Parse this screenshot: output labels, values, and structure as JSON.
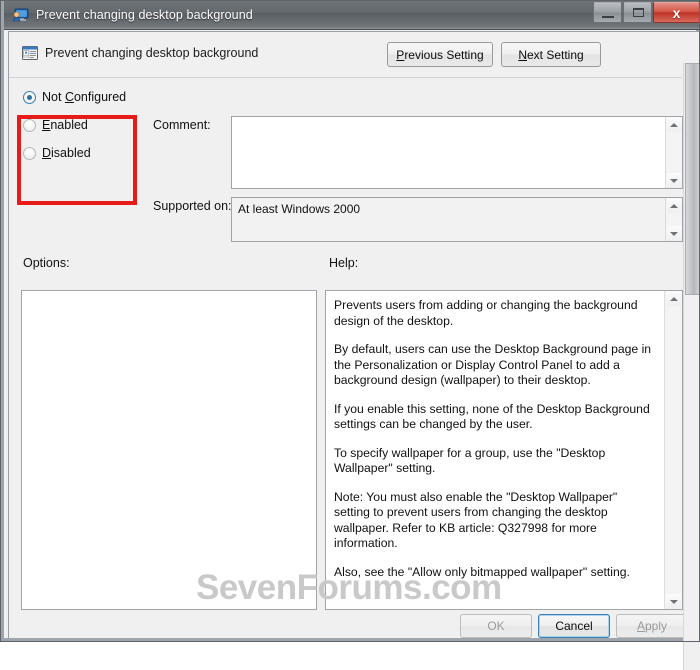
{
  "window": {
    "title": "Prevent changing desktop background",
    "title_icon": "group-policy-monitor-icon",
    "controls": {
      "minimize": "–",
      "maximize": "□",
      "close": "x"
    }
  },
  "header": {
    "icon": "policy-setting-icon",
    "title": "Prevent changing desktop background",
    "previous_setting": "Previous Setting",
    "previous_setting_accel": "P",
    "next_setting": "Next Setting",
    "next_setting_accel": "N"
  },
  "state": {
    "options": [
      {
        "label": "Not Configured",
        "accel": "C",
        "pre": "Not ",
        "post": "onfigured",
        "checked": true
      },
      {
        "label": "Enabled",
        "accel": "E",
        "pre": "",
        "post": "nabled",
        "checked": false
      },
      {
        "label": "Disabled",
        "accel": "D",
        "pre": "",
        "post": "isabled",
        "checked": false
      }
    ],
    "highlight_color": "#e81b1b"
  },
  "form": {
    "comment_label": "Comment:",
    "comment_value": "",
    "supported_label": "Supported on:",
    "supported_value": "At least Windows 2000"
  },
  "panels": {
    "options_label": "Options:",
    "options_content": "",
    "help_label": "Help:",
    "help_paragraphs": [
      "Prevents users from adding or changing the background design of the desktop.",
      "By default, users can use the Desktop Background page in the Personalization or Display Control Panel to add a background design (wallpaper) to their desktop.",
      "If you enable this setting, none of the Desktop Background settings can be changed by the user.",
      "To specify wallpaper for a group, use the \"Desktop Wallpaper\" setting.",
      "Note: You must also enable the \"Desktop Wallpaper\" setting to prevent users from changing the desktop wallpaper. Refer to KB article: Q327998 for more information.",
      "Also, see the \"Allow only bitmapped wallpaper\" setting."
    ]
  },
  "buttons": {
    "ok": "OK",
    "cancel": "Cancel",
    "apply": "Apply",
    "apply_accel": "A"
  },
  "watermark": {
    "text": "SevenForums.com",
    "color": "#c9c9c9"
  }
}
